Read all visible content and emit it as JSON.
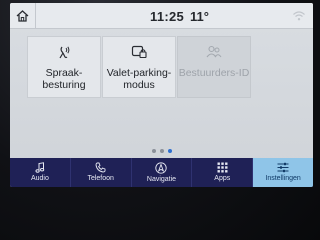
{
  "statusbar": {
    "time": "11:25",
    "temperature": "11°",
    "icons": [
      "home-icon",
      "wifi-icon"
    ]
  },
  "tiles": [
    {
      "label": "Spraak-\nbesturing",
      "icon": "voice-icon",
      "enabled": true
    },
    {
      "label": "Valet-parking-\nmodus",
      "icon": "valet-lock-icon",
      "enabled": true
    },
    {
      "label": "Bestuurders-ID",
      "icon": "driver-id-icon",
      "enabled": false
    }
  ],
  "page_indicator": {
    "total": 3,
    "active": 3
  },
  "nav": [
    {
      "label": "Audio",
      "icon": "music-note-icon",
      "active": false
    },
    {
      "label": "Telefoon",
      "icon": "phone-icon",
      "active": false
    },
    {
      "label": "Navigatie",
      "icon": "navigation-icon",
      "active": false
    },
    {
      "label": "Apps",
      "icon": "apps-grid-icon",
      "active": false
    },
    {
      "label": "Instellingen",
      "icon": "settings-sliders-icon",
      "active": true
    }
  ],
  "colors": {
    "nav_background": "#1f2156",
    "nav_active": "#8fc5e8",
    "screen_background": "#d6dade",
    "dot_active": "#2e6fd0"
  }
}
